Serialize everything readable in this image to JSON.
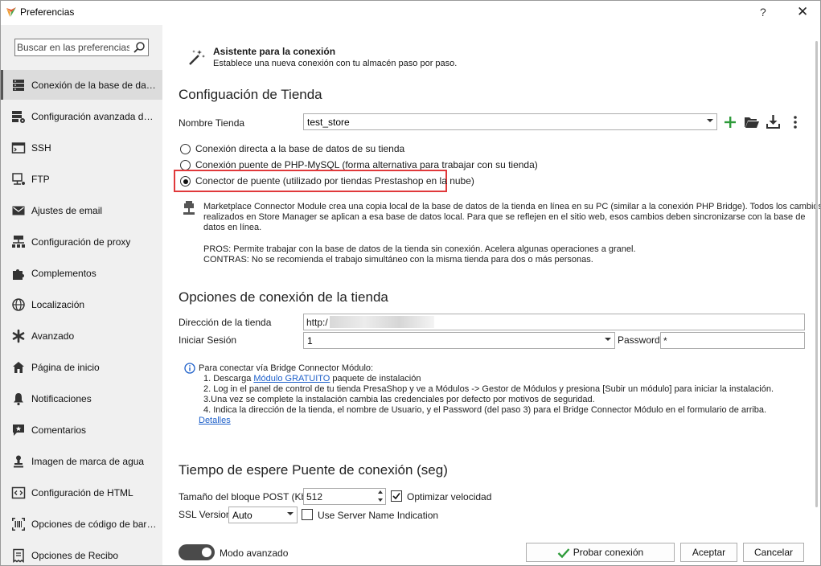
{
  "window": {
    "title": "Preferencias",
    "help_icon": "?",
    "close_icon": "✕"
  },
  "sidebar": {
    "search_placeholder": "Buscar en las preferencias",
    "items": [
      {
        "label": "Conexión de la base de datos",
        "icon": "database-icon",
        "active": true
      },
      {
        "label": "Configuración avanzada de la base de datos",
        "icon": "advanced-db-icon"
      },
      {
        "label": "SSH",
        "icon": "terminal-icon"
      },
      {
        "label": "FTP",
        "icon": "ftp-icon"
      },
      {
        "label": "Ajustes de email",
        "icon": "mail-icon"
      },
      {
        "label": "Configuración de proxy",
        "icon": "proxy-icon"
      },
      {
        "label": "Complementos",
        "icon": "puzzle-icon"
      },
      {
        "label": "Localización",
        "icon": "globe-icon"
      },
      {
        "label": "Avanzado",
        "icon": "asterisk-icon"
      },
      {
        "label": "Página de inicio",
        "icon": "home-icon"
      },
      {
        "label": "Notificaciones",
        "icon": "bell-icon"
      },
      {
        "label": "Comentarios",
        "icon": "comment-icon"
      },
      {
        "label": "Imagen de marca de agua",
        "icon": "watermark-icon"
      },
      {
        "label": "Configuración de HTML",
        "icon": "code-icon"
      },
      {
        "label": "Opciones de código de barras",
        "icon": "barcode-icon"
      },
      {
        "label": "Opciones de Recibo",
        "icon": "receipt-icon"
      }
    ]
  },
  "wizard": {
    "title": "Asistente para la conexión",
    "subtitle": "Establece una nueva conexión con tu almacén paso por paso."
  },
  "store_config": {
    "heading": "Configuación de Tienda",
    "store_name_label": "Nombre Tienda",
    "store_name_value": "test_store",
    "radios": [
      {
        "label": "Conexión directa a la base de datos de su tienda",
        "checked": false
      },
      {
        "label": "Conexión puente de PHP-MySQL (forma alternativa para trabajar con su tienda)",
        "checked": false
      },
      {
        "label": "Conector de puente (utilizado por tiendas Prestashop en la nube)",
        "checked": true
      }
    ],
    "description_lines": [
      "Marketplace Connector Module crea una copia local de la base de datos de la tienda en línea en su PC (similar a la conexión PHP Bridge). Todos los cambios",
      "realizados en Store Manager se aplican a esa base de datos local. Para que se reflejen en el sitio web, esos cambios deben sincronizarse con la base de",
      "datos en línea."
    ],
    "pros": "PROS: Permite trabajar con la base de datos de la tienda sin conexión. Acelera algunas operaciones a granel.",
    "cons": "CONTRAS: No se recomienda el trabajo simultáneo con la misma tienda para dos o más personas."
  },
  "conn_options": {
    "heading": "Opciones de conexión de la tienda",
    "address_label": "Dirección de la tienda",
    "address_value": "http:/",
    "login_label": "Iniciar Sesión",
    "login_value": "1",
    "password_label": "Password",
    "password_value": "*",
    "info_intro": "Para conectar vía Bridge Connector Módulo:",
    "step1_pre": "1. Descarga ",
    "step1_link": "Módulo GRATUITO",
    "step1_post": " paquete de instalación",
    "step2": "2. Log in el panel de control de tu tienda PresaShop y ve a Módulos -> Gestor de Módulos  y presiona [Subir un módulo] para iniciar la instalación.",
    "step3": "3.Una vez se complete la instalación cambia las credenciales por defecto por motivos de seguridad.",
    "step4": "4. Indica la dirección de la tienda, el nombre de Usuario, y el Password (del paso 3) para el Bridge Connector Módulo en el formulario de arriba.",
    "details_link": "Detalles"
  },
  "timeout": {
    "heading": "Tiempo de espere Puente de conexión (seg)",
    "post_label": "Tamaño del bloque POST (Kb)",
    "post_value": "512",
    "optimize_label": "Optimizar velocidad",
    "optimize_checked": true,
    "ssl_label": "SSL Version",
    "ssl_value": "Auto",
    "sni_label": "Use Server Name Indication",
    "sni_checked": false
  },
  "footer": {
    "advanced_toggle_label": "Modo avanzado",
    "test_button": "Probar conexión",
    "accept_button": "Aceptar",
    "cancel_button": "Cancelar"
  },
  "colors": {
    "accent_green": "#2e9b3a",
    "highlight_red": "#e0393b",
    "link_blue": "#1d5fc9",
    "sidebar_bg": "#f0f0f0"
  }
}
